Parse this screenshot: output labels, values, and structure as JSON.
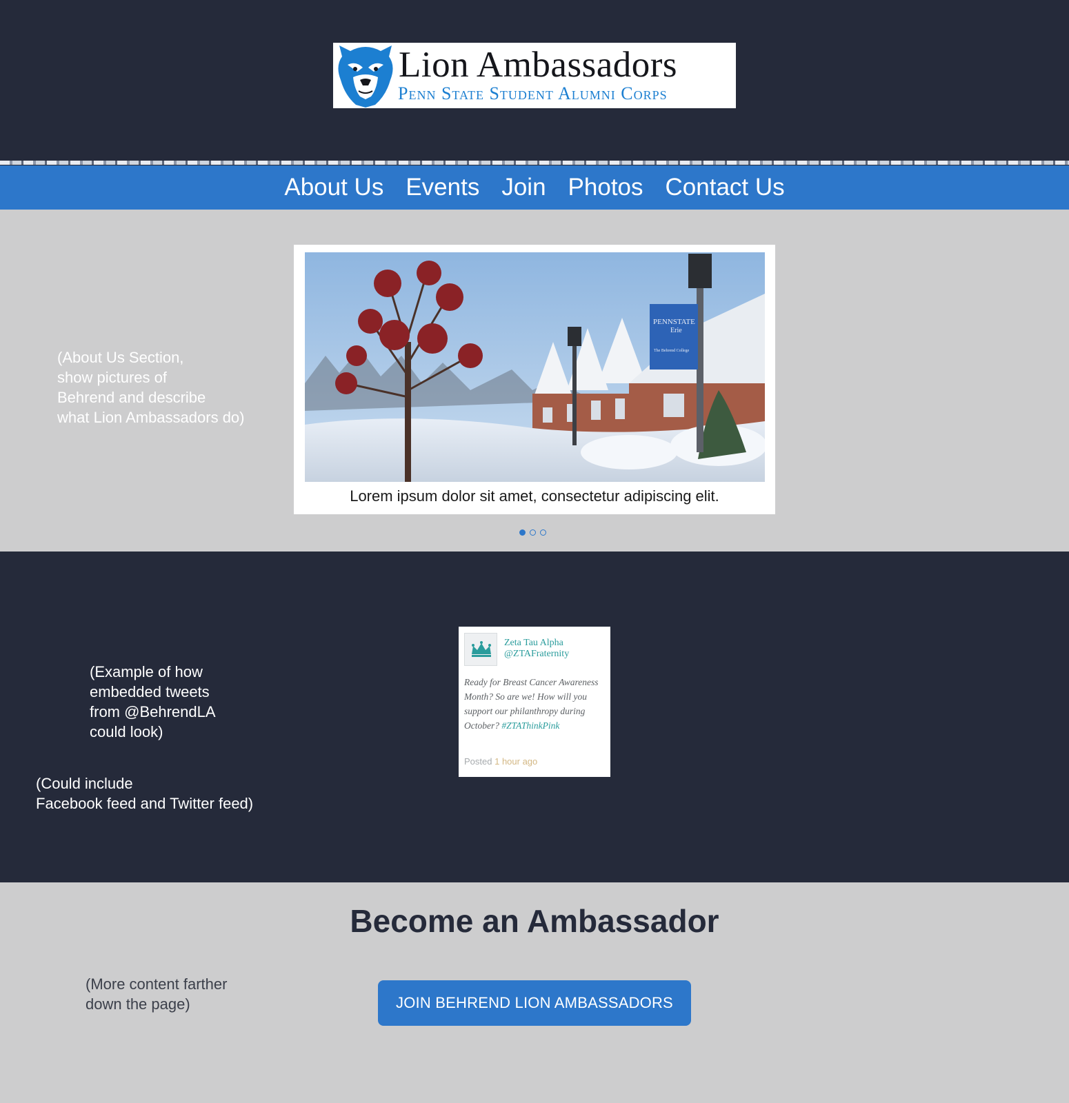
{
  "logo": {
    "title": "Lion Ambassadors",
    "subtitle": "Penn State Student Alumni Corps"
  },
  "nav": {
    "items": [
      {
        "label": "About Us"
      },
      {
        "label": "Events"
      },
      {
        "label": "Join"
      },
      {
        "label": "Photos"
      },
      {
        "label": "Contact Us"
      }
    ]
  },
  "about": {
    "note": "(About Us Section,\nshow pictures of\nBehrend and describe\nwhat Lion Ambassadors do)",
    "slide_caption": "Lorem ipsum dolor sit amet, consectetur adipiscing elit.",
    "slide_count": 3,
    "active_slide": 1,
    "banner_text_1": "PENNSTATE",
    "banner_text_2": "Erie",
    "banner_text_3": "The Behrend College"
  },
  "feed": {
    "note_tweets": "(Example of how\nembedded tweets\nfrom @BehrendLA\ncould look)",
    "note_feeds": "(Could include\nFacebook feed and Twitter feed)",
    "tweet": {
      "name": "Zeta Tau Alpha",
      "handle": "@ZTAFraternity",
      "body": "Ready for Breast Cancer Awareness Month? So are we! How will you support our philanthropy during October?",
      "hashtag": "#ZTAThinkPink",
      "posted_prefix": "Posted",
      "posted_time": "1 hour ago"
    }
  },
  "join": {
    "title": "Become an Ambassador",
    "note": "(More content farther\n down the page)",
    "button_label": "JOIN BEHREND LION AMBASSADORS"
  },
  "colors": {
    "navy": "#252a3a",
    "brand_blue": "#2d77ca",
    "light_gray": "#cdcdce",
    "logo_blue": "#1c7fd1",
    "tweet_teal": "#2a9c9c"
  }
}
